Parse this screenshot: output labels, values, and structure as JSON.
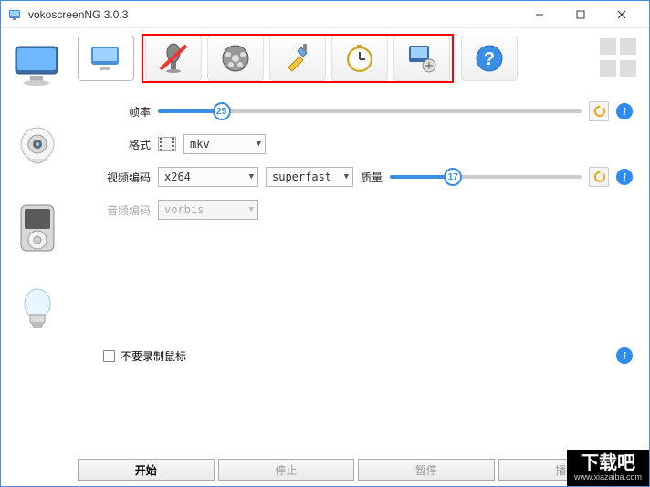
{
  "window": {
    "title": "vokoscreenNG 3.0.3"
  },
  "toolbar": {
    "tabs": [
      "screen",
      "audio",
      "video",
      "tools",
      "timer",
      "area",
      "help",
      "grid"
    ]
  },
  "form": {
    "framerate": {
      "label": "帧率",
      "value": 25,
      "min": 0,
      "max": 100
    },
    "format": {
      "label": "格式",
      "value": "mkv"
    },
    "videocodec": {
      "label": "视频编码",
      "value": "x264",
      "preset": "superfast"
    },
    "quality": {
      "label": "质量",
      "value": 17,
      "min": 0,
      "max": 51
    },
    "audiocodec": {
      "label": "音频编码",
      "value": "vorbis"
    }
  },
  "checkbox": {
    "label": "不要录制鼠标",
    "checked": false
  },
  "buttons": {
    "start": "开始",
    "stop": "停止",
    "pause": "暂停",
    "play": "播放"
  },
  "watermark": {
    "big": "下载吧",
    "url": "www.xiazaiba.com"
  }
}
